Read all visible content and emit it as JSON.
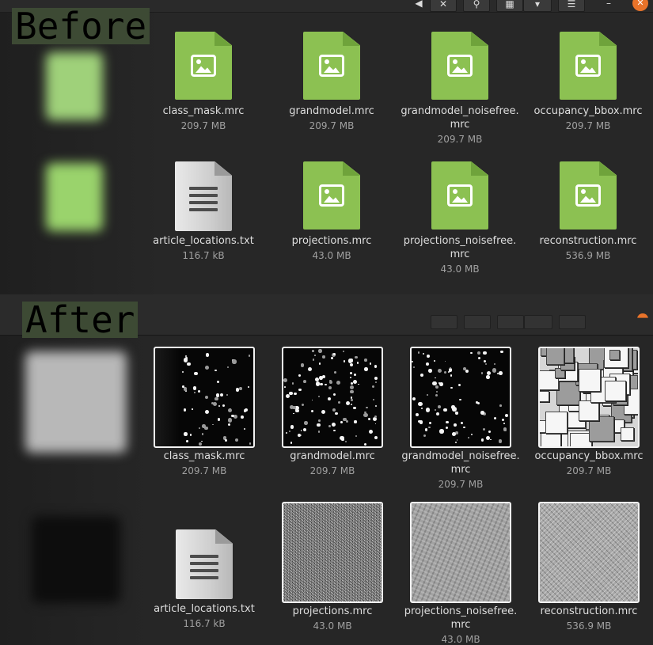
{
  "labels": {
    "before": "Before",
    "after": "After"
  },
  "toolbar": {
    "buttons": [
      {
        "icon": "close-icon",
        "glyph": "✕"
      },
      {
        "icon": "search-icon",
        "glyph": "⚲"
      },
      {
        "icon": "view-icon",
        "glyph": "▦"
      },
      {
        "icon": "chevron-down-icon",
        "glyph": "▾"
      },
      {
        "icon": "settings-icon",
        "glyph": "☰"
      },
      {
        "icon": "minimize-icon",
        "glyph": "–"
      }
    ],
    "close_glyph": "✕"
  },
  "before": {
    "files": [
      {
        "name": "class_mask.mrc",
        "size": "209.7 MB",
        "icon": "image-file-icon"
      },
      {
        "name": "grandmodel.mrc",
        "size": "209.7 MB",
        "icon": "image-file-icon"
      },
      {
        "name": "grandmodel_noisefree.\nmrc",
        "size": "209.7 MB",
        "icon": "image-file-icon"
      },
      {
        "name": "occupancy_bbox.mrc",
        "size": "209.7 MB",
        "icon": "image-file-icon"
      },
      {
        "name": "article_locations.txt",
        "size": "116.7 kB",
        "icon": "text-file-icon"
      },
      {
        "name": "projections.mrc",
        "size": "43.0 MB",
        "icon": "image-file-icon"
      },
      {
        "name": "projections_noisefree.\nmrc",
        "size": "43.0 MB",
        "icon": "image-file-icon"
      },
      {
        "name": "reconstruction.mrc",
        "size": "536.9 MB",
        "icon": "image-file-icon"
      }
    ]
  },
  "after": {
    "files": [
      {
        "name": "class_mask.mrc",
        "size": "209.7 MB",
        "thumb": "dots-sparse"
      },
      {
        "name": "grandmodel.mrc",
        "size": "209.7 MB",
        "thumb": "dots"
      },
      {
        "name": "grandmodel_noisefree.\nmrc",
        "size": "209.7 MB",
        "thumb": "dots"
      },
      {
        "name": "occupancy_bbox.mrc",
        "size": "209.7 MB",
        "thumb": "boxes"
      },
      {
        "name": "article_locations.txt",
        "size": "116.7 kB",
        "thumb": "text-file-icon"
      },
      {
        "name": "projections.mrc",
        "size": "43.0 MB",
        "thumb": "noise"
      },
      {
        "name": "projections_noisefree.\nmrc",
        "size": "43.0 MB",
        "thumb": "grey"
      },
      {
        "name": "reconstruction.mrc",
        "size": "536.9 MB",
        "thumb": "relief"
      }
    ]
  },
  "colors": {
    "image_icon": "#8cc152",
    "badge": "#3d4a34",
    "close": "#e8732a"
  }
}
